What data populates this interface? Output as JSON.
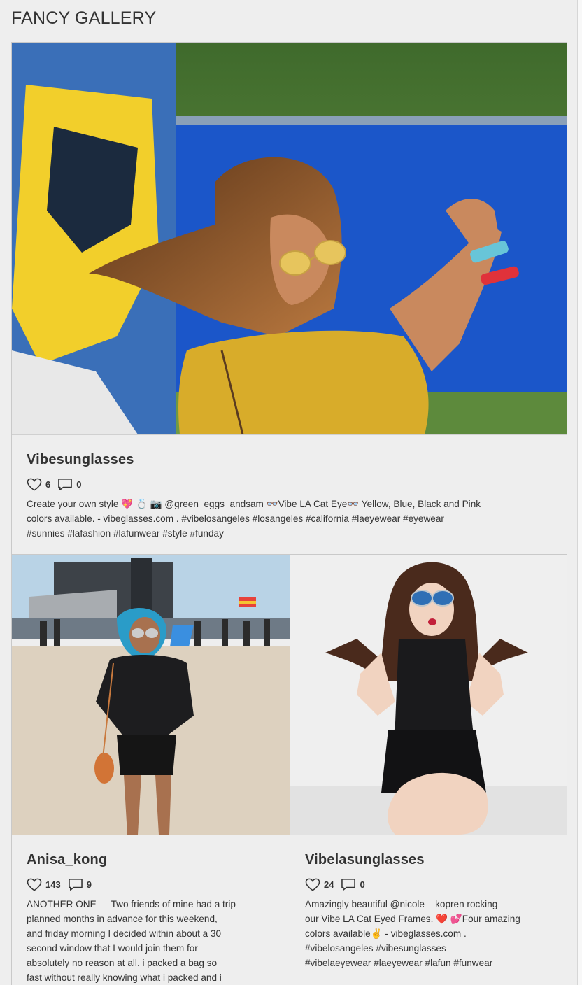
{
  "gallery": {
    "title": "FANCY GALLERY"
  },
  "posts": [
    {
      "username": "Vibesunglasses",
      "likes": "6",
      "comments": "0",
      "caption": "Create your own style 💖 💍 📷 @green_eggs_andsam 👓Vibe LA Cat Eye👓 Yellow, Blue, Black and Pink\ncolors available. - vibeglasses.com . #vibelosangeles #losangeles #california #laeyewear #eyewear\n#sunnies #lafashion #lafunwear #style #funday"
    },
    {
      "username": "Anisa_kong",
      "likes": "143",
      "comments": "9",
      "caption": "ANOTHER ONE — Two friends of mine had a trip\nplanned months in advance for this weekend,\nand friday morning I decided within about a 30\nsecond window that I would join them for\nabsolutely no reason at all. i packed a bag so\nfast without really knowing what i packed and i"
    },
    {
      "username": "Vibelasunglasses",
      "likes": "24",
      "comments": "0",
      "caption": "Amazingly beautiful @nicole__kopren  rocking\nour Vibe LA Cat Eyed Frames. ❤️ 💕Four amazing\ncolors available✌️ - vibeglasses.com .\n#vibelosangeles #vibesunglasses\n#vibelaeyewear #laeyewear #lafun #funwear"
    }
  ],
  "icons": {
    "like": "heart-icon",
    "comment": "comment-icon"
  }
}
